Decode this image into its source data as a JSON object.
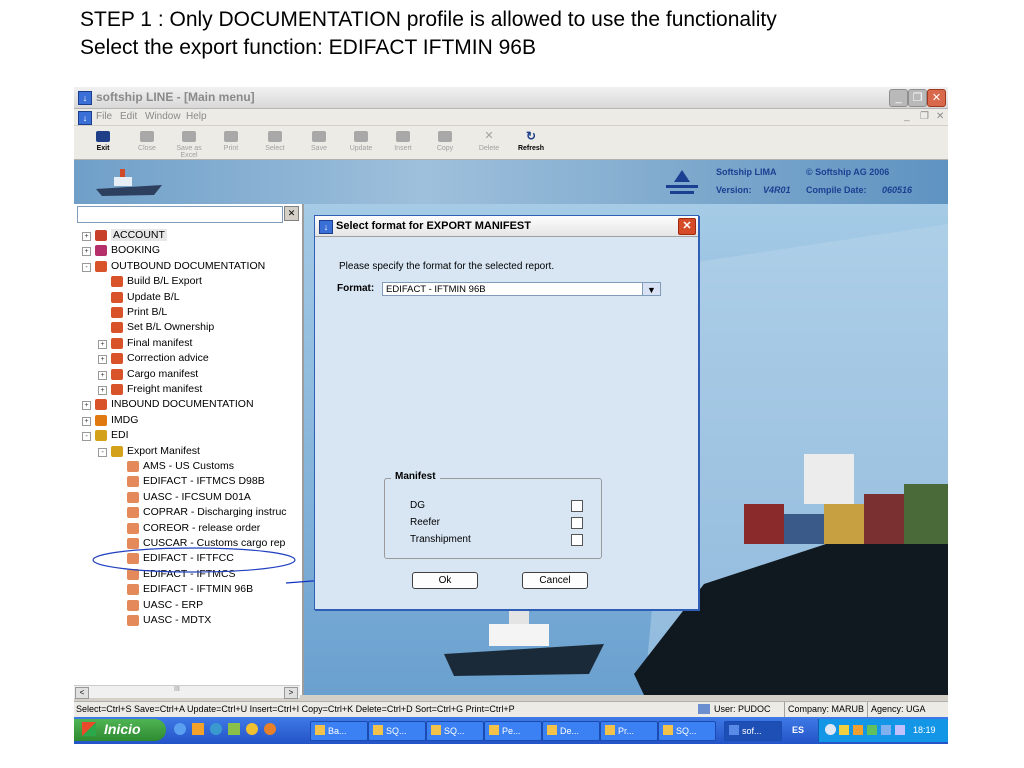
{
  "caption": {
    "line1": "STEP 1 : Only DOCUMENTATION profile is allowed to use the functionality",
    "line2": "Select the export function: EDIFACT IFTMIN 96B"
  },
  "window": {
    "title": "softship LINE - [Main menu]"
  },
  "menu": [
    "File",
    "Edit",
    "Window",
    "Help"
  ],
  "toolbar": [
    "Exit",
    "Close",
    "Save as Excel",
    "Print",
    "Select",
    "Save",
    "Update",
    "Insert",
    "Copy",
    "Delete",
    "Refresh"
  ],
  "banner": {
    "product": "Softship LIMA",
    "copyright": "© Softship AG 2006",
    "version_label": "Version:",
    "version": "V4R01",
    "compile_label": "Compile Date:",
    "compile_date": "060516"
  },
  "tree": [
    {
      "label": "ACCOUNT",
      "level": 0,
      "exp": "+",
      "icon": "account-icon",
      "color": "#c8402a"
    },
    {
      "label": "BOOKING",
      "level": 0,
      "exp": "+",
      "icon": "booking-icon",
      "color": "#b5306a"
    },
    {
      "label": "OUTBOUND DOCUMENTATION",
      "level": 0,
      "exp": "-",
      "icon": "outbound-icon",
      "color": "#d9532a"
    },
    {
      "label": "Build B/L Export",
      "level": 1,
      "exp": "",
      "icon": "document-icon",
      "color": "#d9532a"
    },
    {
      "label": "Update B/L",
      "level": 1,
      "exp": "",
      "icon": "document-icon",
      "color": "#d9532a"
    },
    {
      "label": "Print B/L",
      "level": 1,
      "exp": "",
      "icon": "document-icon",
      "color": "#d9532a"
    },
    {
      "label": "Set B/L Ownership",
      "level": 1,
      "exp": "",
      "icon": "document-icon",
      "color": "#d9532a"
    },
    {
      "label": "Final manifest",
      "level": 1,
      "exp": "+",
      "icon": "document-icon",
      "color": "#d9532a"
    },
    {
      "label": "Correction advice",
      "level": 1,
      "exp": "+",
      "icon": "document-icon",
      "color": "#d9532a"
    },
    {
      "label": "Cargo manifest",
      "level": 1,
      "exp": "+",
      "icon": "document-icon",
      "color": "#d9532a"
    },
    {
      "label": "Freight manifest",
      "level": 1,
      "exp": "+",
      "icon": "document-icon",
      "color": "#d9532a"
    },
    {
      "label": "INBOUND DOCUMENTATION",
      "level": 0,
      "exp": "+",
      "icon": "inbound-icon",
      "color": "#d9532a"
    },
    {
      "label": "IMDG",
      "level": 0,
      "exp": "+",
      "icon": "imdg-icon",
      "color": "#e07a10"
    },
    {
      "label": "EDI",
      "level": 0,
      "exp": "-",
      "icon": "edi-icon",
      "color": "#d4a21a"
    },
    {
      "label": "Export Manifest",
      "level": 1,
      "exp": "-",
      "icon": "edi-icon",
      "color": "#d4a21a"
    },
    {
      "label": "AMS - US Customs",
      "level": 2,
      "exp": "",
      "icon": "edi-item-icon",
      "color": "#e48a5a"
    },
    {
      "label": "EDIFACT - IFTMCS D98B",
      "level": 2,
      "exp": "",
      "icon": "edi-item-icon",
      "color": "#e48a5a"
    },
    {
      "label": "UASC - IFCSUM D01A",
      "level": 2,
      "exp": "",
      "icon": "edi-item-icon",
      "color": "#e48a5a"
    },
    {
      "label": "COPRAR - Discharging instruc",
      "level": 2,
      "exp": "",
      "icon": "edi-item-icon",
      "color": "#e48a5a"
    },
    {
      "label": "COREOR - release order",
      "level": 2,
      "exp": "",
      "icon": "edi-item-icon",
      "color": "#e48a5a"
    },
    {
      "label": "CUSCAR - Customs cargo rep",
      "level": 2,
      "exp": "",
      "icon": "edi-item-icon",
      "color": "#e48a5a"
    },
    {
      "label": "EDIFACT - IFTFCC",
      "level": 2,
      "exp": "",
      "icon": "edi-item-icon",
      "color": "#e48a5a"
    },
    {
      "label": "EDIFACT - IFTMCS",
      "level": 2,
      "exp": "",
      "icon": "edi-item-icon",
      "color": "#e48a5a"
    },
    {
      "label": "EDIFACT - IFTMIN 96B",
      "level": 2,
      "exp": "",
      "icon": "edi-item-icon",
      "color": "#e48a5a"
    },
    {
      "label": "UASC - ERP",
      "level": 2,
      "exp": "",
      "icon": "edi-item-icon",
      "color": "#e48a5a"
    },
    {
      "label": "UASC - MDTX",
      "level": 2,
      "exp": "",
      "icon": "edi-item-icon",
      "color": "#e48a5a"
    }
  ],
  "dialog": {
    "title": "Select format for EXPORT MANIFEST",
    "prompt": "Please specify the format for the selected report.",
    "format_label": "Format:",
    "format_value": "EDIFACT - IFTMIN 96B",
    "manifest_legend": "Manifest",
    "options": [
      {
        "label": "DG",
        "checked": false
      },
      {
        "label": "Reefer",
        "checked": false
      },
      {
        "label": "Transhipment",
        "checked": false
      }
    ],
    "ok": "Ok",
    "cancel": "Cancel"
  },
  "statusbar": {
    "shortcuts": "Select=Ctrl+S  Save=Ctrl+A  Update=Ctrl+U  Insert=Ctrl+I  Copy=Ctrl+K  Delete=Ctrl+D  Sort=Ctrl+G  Print=Ctrl+P",
    "user": "User: PUDOC",
    "company": "Company: MARUB",
    "agency": "Agency: UGA"
  },
  "taskbar": {
    "start": "Inicio",
    "tasks": [
      "Ba...",
      "SQ...",
      "SQ...",
      "Pe...",
      "De...",
      "Pr...",
      "SQ...",
      "sof..."
    ],
    "lang": "ES",
    "clock": "18:19"
  },
  "scroll": {
    "left": "<",
    "right": ">",
    "mid": "III"
  }
}
